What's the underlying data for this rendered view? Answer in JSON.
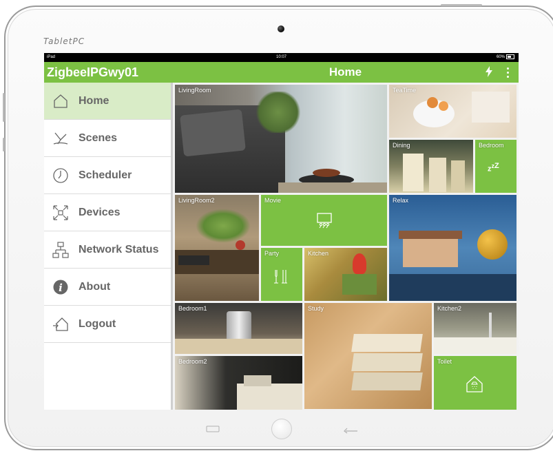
{
  "device": {
    "brand": "TabletPC"
  },
  "status_bar": {
    "carrier": "iPad",
    "time": "10:07",
    "battery": "60%"
  },
  "app": {
    "gateway_name": "ZigbeeIPGwy01",
    "title": "Home",
    "accent": "#7cc143",
    "active_bg": "#d9ecc7"
  },
  "menu": [
    {
      "label": "Home",
      "icon": "home-icon",
      "active": true
    },
    {
      "label": "Scenes",
      "icon": "scenes-icon",
      "active": false
    },
    {
      "label": "Scheduler",
      "icon": "clock-icon",
      "active": false
    },
    {
      "label": "Devices",
      "icon": "devices-icon",
      "active": false
    },
    {
      "label": "Network Status",
      "icon": "network-icon",
      "active": false
    },
    {
      "label": "About",
      "icon": "info-icon",
      "active": false
    },
    {
      "label": "Logout",
      "icon": "logout-icon",
      "active": false
    }
  ],
  "tiles": {
    "livingroom": "LivingRoom",
    "teatime": "TeaTime",
    "dining": "Dining",
    "bedroom": "Bedroom",
    "livingroom2": "LivingRoom2",
    "movie": "Movie",
    "relax": "Relax",
    "party": "Party",
    "kitchen": "Kitchen",
    "bedroom1": "Bedroom1",
    "study": "Study",
    "kitchen2": "Kitchen2",
    "bedroom2": "Bedroom2",
    "toilet": "Toilet"
  }
}
